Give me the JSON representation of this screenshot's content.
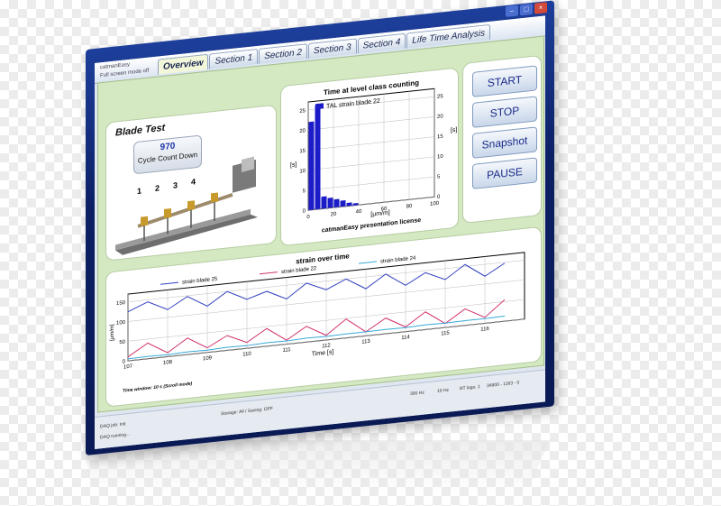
{
  "window": {
    "title": "catmanEasy",
    "subtitle": "Full screen mode off",
    "tabs": [
      {
        "label": "Overview",
        "active": true
      },
      {
        "label": "Section 1"
      },
      {
        "label": "Section 2"
      },
      {
        "label": "Section 3"
      },
      {
        "label": "Section 4"
      },
      {
        "label": "Life Time Analysis"
      }
    ]
  },
  "blade_panel": {
    "title": "Blade Test",
    "counter_value": "970",
    "counter_label": "Cycle Count Down",
    "position_labels": [
      "1",
      "2",
      "3",
      "4"
    ]
  },
  "controls": {
    "start": "START",
    "stop": "STOP",
    "snapshot": "Snapshot",
    "pause": "PAUSE"
  },
  "histogram": {
    "title": "Time at level class counting",
    "legend": "TAL strain blade 22",
    "xlabel": "[μm/m]",
    "ylabel_left": "[s]",
    "ylabel_right": "[s]",
    "footer": "catmanEasy presentation license",
    "x_ticks": [
      "0",
      "20",
      "40",
      "60",
      "80",
      "100"
    ],
    "y_ticks_left": [
      "0",
      "5",
      "10",
      "15",
      "20",
      "25"
    ],
    "y_ticks_right": [
      "0",
      "5",
      "10",
      "15",
      "20",
      "25"
    ]
  },
  "strain_chart": {
    "title": "strain over time",
    "legend": [
      "strain blade 25",
      "strain blade 22",
      "strain blade 24"
    ],
    "xlabel": "Time [s]",
    "ylabel": "[μm/m]",
    "x_ticks": [
      "107",
      "108",
      "109",
      "110",
      "111",
      "112",
      "113",
      "114",
      "115",
      "116"
    ],
    "y_ticks": [
      "0",
      "50",
      "100",
      "150"
    ],
    "footnote": "Time window: 10 s (Scroll mode)"
  },
  "statusbar": {
    "job": "DAQ job: Init",
    "storage": "Storage: All / Saving: OFF",
    "running": "DAQ running...",
    "rate1": "300 Hz",
    "rate2": "10 Hz",
    "rt": "RT logs: 1",
    "count": "34900 - 1163 - 0"
  },
  "chart_data": [
    {
      "type": "bar",
      "title": "Time at level class counting",
      "categories": [
        "0-5",
        "5-10",
        "10-15",
        "15-20",
        "20-25",
        "25-30",
        "30-35",
        "35-40"
      ],
      "values": [
        22,
        26,
        3,
        2.5,
        2,
        1.5,
        0.8,
        0.5
      ],
      "xlabel": "[μm/m]",
      "ylabel": "[s]",
      "ylim": [
        0,
        27
      ],
      "legend": [
        "TAL strain blade 22"
      ]
    },
    {
      "type": "line",
      "title": "strain over time",
      "xlabel": "Time [s]",
      "ylabel": "[μm/m]",
      "x": [
        107,
        107.5,
        108,
        108.5,
        109,
        109.5,
        110,
        110.5,
        111,
        111.5,
        112,
        112.5,
        113,
        113.5,
        114,
        114.5,
        115,
        115.5,
        116,
        116.5
      ],
      "series": [
        {
          "name": "strain blade 25",
          "color": "#2f3fbf",
          "values": [
            125,
            145,
            120,
            148,
            118,
            150,
            125,
            140,
            115,
            150,
            128,
            150,
            120,
            152,
            118,
            145,
            122,
            155,
            120,
            148
          ]
        },
        {
          "name": "strain blade 22",
          "color": "#d0306e",
          "values": [
            10,
            40,
            10,
            42,
            12,
            38,
            15,
            45,
            10,
            40,
            12,
            48,
            10,
            40,
            12,
            45,
            10,
            42,
            15,
            55
          ]
        },
        {
          "name": "strain blade 24",
          "color": "#36a8d8",
          "values": [
            5,
            6,
            5,
            7,
            6,
            8,
            7,
            9,
            8,
            10,
            9,
            10,
            10,
            11,
            10,
            12,
            11,
            12,
            12,
            13
          ]
        }
      ],
      "ylim": [
        0,
        170
      ]
    }
  ]
}
